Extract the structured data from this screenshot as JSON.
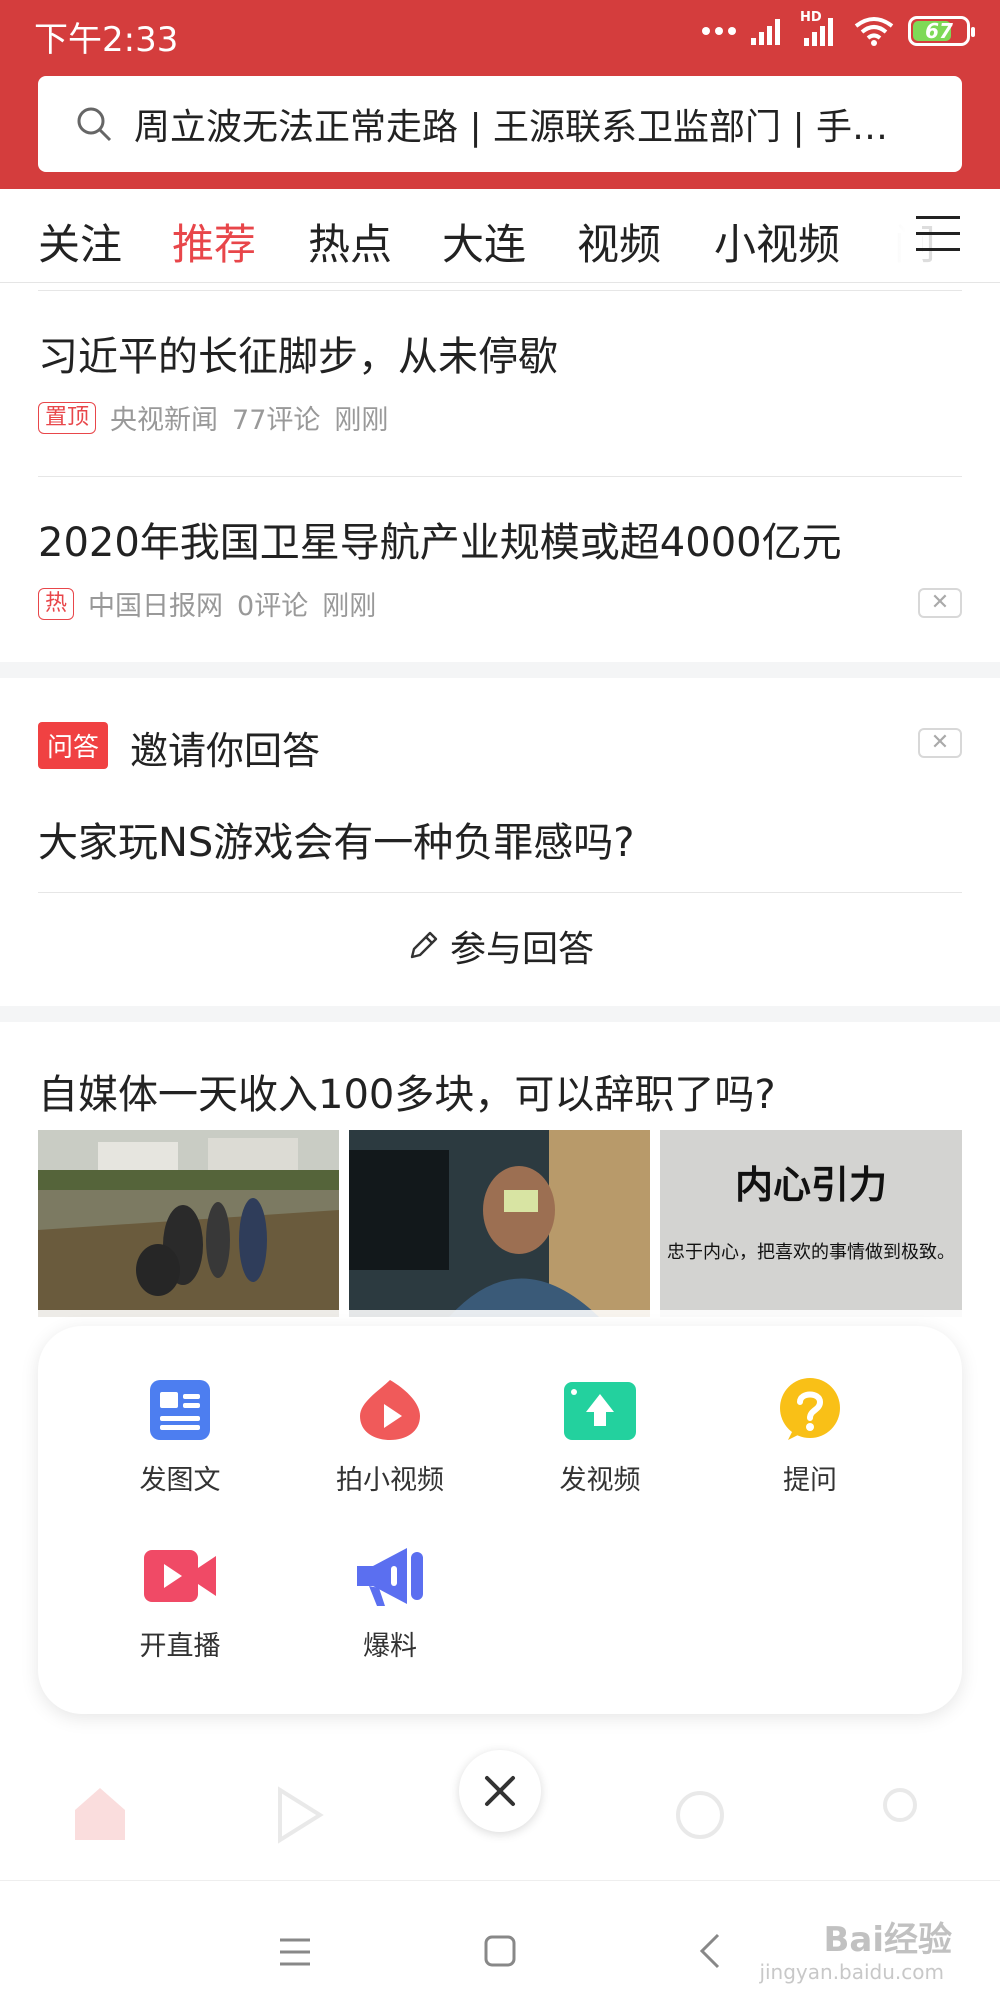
{
  "status_bar": {
    "time": "下午2:33",
    "signal_label": "HD",
    "battery": "67",
    "battery_level": 0.67
  },
  "search": {
    "text": "周立波无法正常走路 | 王源联系卫监部门 | 手…",
    "icon": "search-icon"
  },
  "tabs": [
    {
      "label": "关注",
      "active": false
    },
    {
      "label": "推荐",
      "active": true
    },
    {
      "label": "热点",
      "active": false
    },
    {
      "label": "大连",
      "active": false
    },
    {
      "label": "视频",
      "active": false
    },
    {
      "label": "小视频",
      "active": false
    },
    {
      "label": "问",
      "active": false
    }
  ],
  "feed": {
    "article1": {
      "title": "习近平的长征脚步，从未停歇",
      "tag": "置顶",
      "source": "央视新闻",
      "comments": "77评论",
      "time": "刚刚"
    },
    "article2": {
      "title": "2020年我国卫星导航产业规模或超4000亿元",
      "tag": "热",
      "source": "中国日报网",
      "comments": "0评论",
      "time": "刚刚"
    },
    "qa": {
      "badge": "问答",
      "invite": "邀请你回答",
      "question": "大家玩NS游戏会有一种负罪感吗?",
      "answer_label": "参与回答"
    },
    "article3": {
      "title": "自媒体一天收入100多块，可以辞职了吗?",
      "image3_title": "内心引力",
      "image3_sub": "忠于内心，把喜欢的事情做到极致。"
    }
  },
  "publish_menu": {
    "items": [
      {
        "label": "发图文",
        "icon": "image-text-icon",
        "color": "#4d7ef0"
      },
      {
        "label": "拍小视频",
        "icon": "short-video-icon",
        "color": "#f05a5a"
      },
      {
        "label": "发视频",
        "icon": "upload-video-icon",
        "color": "#23d19e"
      },
      {
        "label": "提问",
        "icon": "question-icon",
        "color": "#f9c017"
      },
      {
        "label": "开直播",
        "icon": "live-camera-icon",
        "color": "#f04a66"
      },
      {
        "label": "爆料",
        "icon": "megaphone-icon",
        "color": "#5b6ff0"
      }
    ],
    "close_icon": "close-icon"
  },
  "watermark": {
    "text": "Bai经验",
    "url": "jingyan.baidu.com"
  },
  "colors": {
    "brand": "#d43d3d",
    "accent": "#e8464a"
  }
}
